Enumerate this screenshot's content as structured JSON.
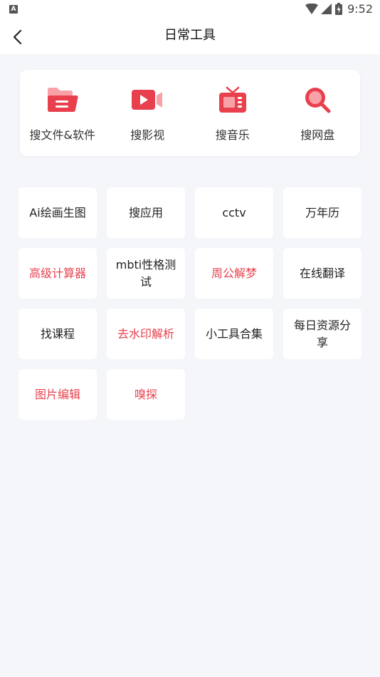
{
  "status": {
    "time": "9:52"
  },
  "header": {
    "title": "日常工具"
  },
  "search_items": [
    {
      "label": "搜文件&软件",
      "icon": "folder-icon"
    },
    {
      "label": "搜影视",
      "icon": "video-icon"
    },
    {
      "label": "搜音乐",
      "icon": "tv-music-icon"
    },
    {
      "label": "搜网盘",
      "icon": "search-magnifier-icon"
    }
  ],
  "tools": [
    {
      "label": "Ai绘画生图",
      "highlight": false
    },
    {
      "label": "搜应用",
      "highlight": false
    },
    {
      "label": "cctv",
      "highlight": false
    },
    {
      "label": "万年历",
      "highlight": false
    },
    {
      "label": "高级计算器",
      "highlight": true
    },
    {
      "label": "mbti性格测试",
      "highlight": false
    },
    {
      "label": "周公解梦",
      "highlight": true
    },
    {
      "label": "在线翻译",
      "highlight": false
    },
    {
      "label": "找课程",
      "highlight": false
    },
    {
      "label": "去水印解析",
      "highlight": true
    },
    {
      "label": "小工具合集",
      "highlight": false
    },
    {
      "label": "每日资源分享",
      "highlight": false
    },
    {
      "label": "图片编辑",
      "highlight": true
    },
    {
      "label": "嗅探",
      "highlight": true
    }
  ],
  "colors": {
    "accent": "#e8414d",
    "accent_light": "#f8a2a8",
    "background": "#f5f6f9"
  }
}
